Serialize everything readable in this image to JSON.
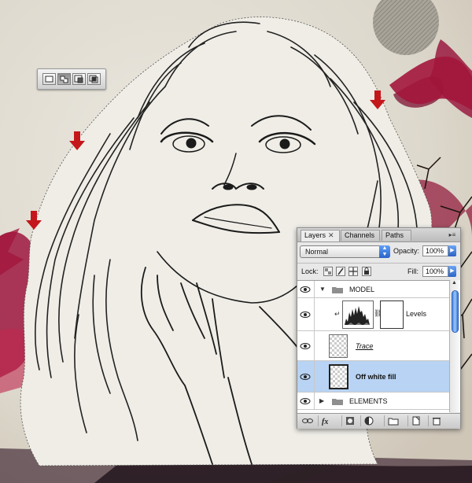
{
  "selection_mode_toolbar": {
    "buttons": [
      "new-selection",
      "add-to-selection",
      "subtract-from-selection",
      "intersect-with-selection"
    ],
    "active_index": 1
  },
  "layers_panel": {
    "tabs": [
      {
        "label": "Layers",
        "active": true,
        "closable": true
      },
      {
        "label": "Channels",
        "active": false,
        "closable": false
      },
      {
        "label": "Paths",
        "active": false,
        "closable": false
      }
    ],
    "blend_mode": "Normal",
    "opacity_label": "Opacity:",
    "opacity_value": "100%",
    "lock_label": "Lock:",
    "fill_label": "Fill:",
    "fill_value": "100%",
    "layers": [
      {
        "name": "MODEL",
        "type": "group",
        "expanded": true,
        "visible": true
      },
      {
        "name": "Levels",
        "type": "adjustment",
        "visible": true
      },
      {
        "name": "Trace",
        "type": "pixel",
        "visible": true
      },
      {
        "name": "Off white fill",
        "type": "pixel",
        "visible": true,
        "selected": true
      },
      {
        "name": "ELEMENTS",
        "type": "group",
        "expanded": false,
        "visible": true
      }
    ],
    "bottom_buttons": [
      "link-layers",
      "layer-style",
      "add-mask",
      "adjustment-layer",
      "new-group",
      "new-layer",
      "delete-layer"
    ]
  },
  "colors": {
    "arrow_red": "#c4171b",
    "selection_blue": "#b8d3f3",
    "accent_blue": "#2a63c9",
    "bird_magenta": "#a3163c"
  }
}
